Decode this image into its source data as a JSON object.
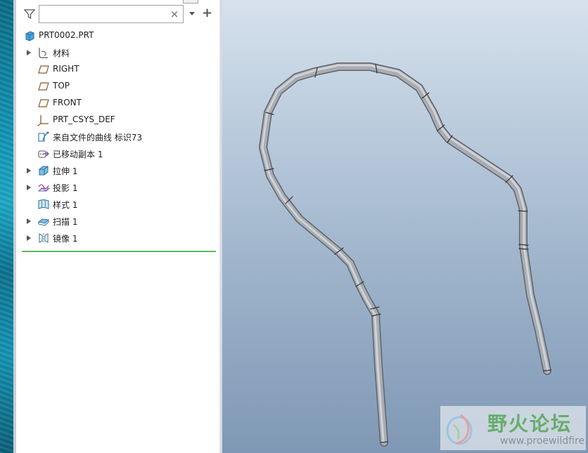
{
  "filter": {
    "search_value": "",
    "search_placeholder": ""
  },
  "tree": {
    "root": {
      "label": "PRT0002.PRT",
      "icon": "part-cube-icon"
    },
    "items": [
      {
        "label": "材料",
        "icon": "material-icon",
        "expandable": true
      },
      {
        "label": "RIGHT",
        "icon": "datum-plane-icon",
        "expandable": false
      },
      {
        "label": "TOP",
        "icon": "datum-plane-icon",
        "expandable": false
      },
      {
        "label": "FRONT",
        "icon": "datum-plane-icon",
        "expandable": false
      },
      {
        "label": "PRT_CSYS_DEF",
        "icon": "coordinate-system-icon",
        "expandable": false
      },
      {
        "label": "来自文件的曲线 标识73",
        "icon": "curve-from-file-icon",
        "expandable": false
      },
      {
        "label": "已移动副本 1",
        "icon": "moved-copy-icon",
        "expandable": false
      },
      {
        "label": "拉伸 1",
        "icon": "extrude-icon",
        "expandable": true
      },
      {
        "label": "投影 1",
        "icon": "projection-icon",
        "expandable": true
      },
      {
        "label": "样式 1",
        "icon": "style-surface-icon",
        "expandable": false
      },
      {
        "label": "扫描 1",
        "icon": "sweep-icon",
        "expandable": true
      },
      {
        "label": "镜像 1",
        "icon": "mirror-icon",
        "expandable": true
      }
    ]
  },
  "watermark": {
    "title": "野火论坛",
    "url": "www.proewildfire.cn"
  },
  "colors": {
    "insert_line": "#5cb85c",
    "tube_fill": "#a9adb3",
    "tube_outline": "#5f6469"
  }
}
